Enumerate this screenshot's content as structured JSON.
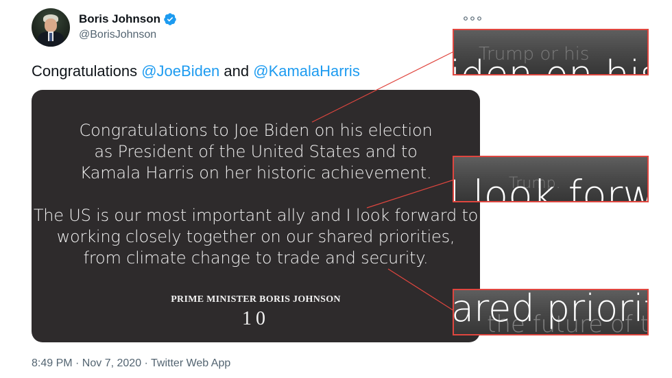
{
  "tweet": {
    "author_name": "Boris Johnson",
    "author_handle": "@BorisJohnson",
    "text_prefix": "Congratulations ",
    "mention_1": "@JoeBiden",
    "text_middle": " and ",
    "mention_2": "@KamalaHarris",
    "timestamp": "8:49 PM · Nov 7, 2020",
    "separator": " · ",
    "source": "Twitter Web App"
  },
  "card": {
    "lines": [
      "Congratulations to Joe Biden on his election",
      "as President of the United States and to",
      "Kamala Harris on her historic achievement.",
      "The US is our most important ally and I look forward to",
      "working closely together on our shared priorities,",
      "from climate change to trade and security."
    ],
    "signature": "PRIME MINISTER BORIS JOHNSON",
    "logo_text": "10"
  },
  "zooms": [
    {
      "faint_text": "Trump or his",
      "big_text": "iden on his"
    },
    {
      "faint_text": "Trump.",
      "big_text": "I look forw"
    },
    {
      "faint_text": "the future of this",
      "big_text": "ared priorit"
    }
  ],
  "colors": {
    "mention": "#1d9bf0",
    "secondary_text": "#536471",
    "card_background": "#2e2b2c",
    "callout_border": "#e0463f",
    "verified_badge": "#1d9bf0"
  },
  "icons": {
    "verified": "verified-badge-icon",
    "more": "more-options-icon"
  }
}
